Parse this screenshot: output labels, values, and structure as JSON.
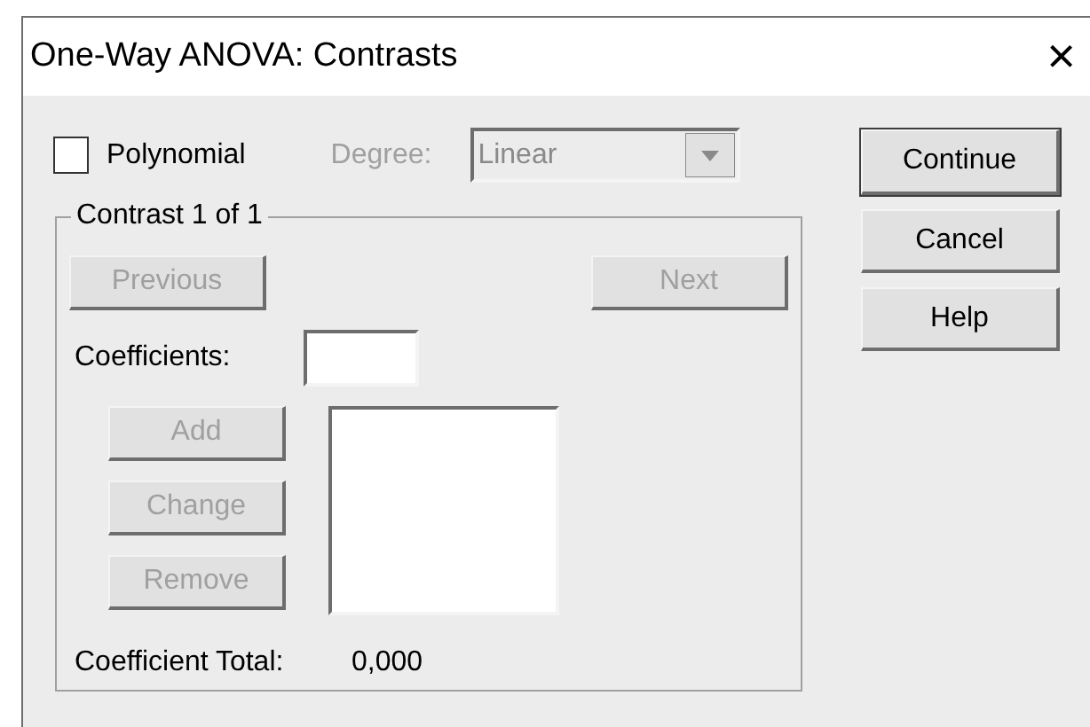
{
  "window": {
    "title": "One-Way ANOVA: Contrasts",
    "close": "×"
  },
  "polynomial": {
    "label": "Polynomial",
    "checked": false
  },
  "degree": {
    "label": "Degree:",
    "value": "Linear",
    "disabled": true
  },
  "dialog_buttons": [
    {
      "label": "Continue",
      "default": true
    },
    {
      "label": "Cancel",
      "default": false
    },
    {
      "label": "Help",
      "default": false
    }
  ],
  "contrast": {
    "legend": "Contrast 1 of 1",
    "nav_buttons": [
      {
        "label": "Previous",
        "disabled": true
      },
      {
        "label": "Next",
        "disabled": true
      }
    ],
    "coefficients_label": "Coefficients:",
    "edit_buttons": [
      {
        "label": "Add",
        "disabled": true
      },
      {
        "label": "Change",
        "disabled": true
      },
      {
        "label": "Remove",
        "disabled": true
      }
    ],
    "total_label": "Coefficient Total:",
    "total_value": "0,000"
  }
}
